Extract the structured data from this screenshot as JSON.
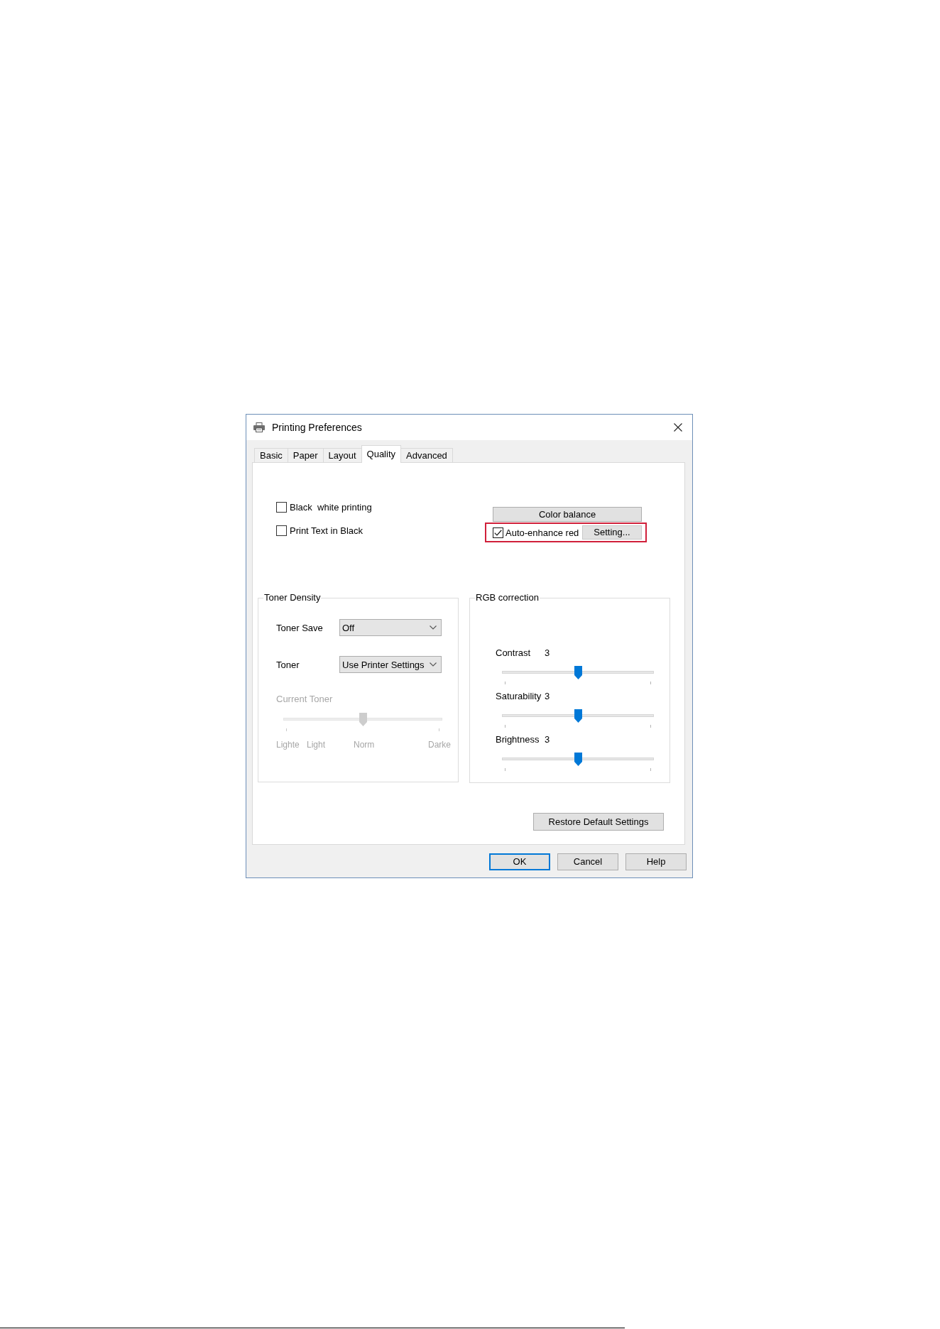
{
  "window": {
    "title": "Printing Preferences"
  },
  "tabs": [
    {
      "label": "Basic",
      "selected": false
    },
    {
      "label": "Paper",
      "selected": false
    },
    {
      "label": "Layout",
      "selected": false
    },
    {
      "label": "Quality",
      "selected": true
    },
    {
      "label": "Advanced",
      "selected": false
    }
  ],
  "options": [
    {
      "label": "Black  white printing",
      "checked": false
    },
    {
      "label": "Print Text in Black",
      "checked": false
    }
  ],
  "color_balance_button": {
    "label": "Color balance"
  },
  "auto_enhance": {
    "label": "Auto-enhance red",
    "checked": true,
    "highlighted": true,
    "button": "Setting..."
  },
  "toner_density": {
    "title": "Toner Density",
    "dropdowns": [
      {
        "label": "Toner Save",
        "value": "Off"
      },
      {
        "label": "Toner",
        "value": "Use Printer Settings"
      }
    ],
    "current_toner": {
      "label": "Current Toner",
      "disabled": true,
      "level": 0.5,
      "scale_labels": [
        "Lighte",
        "Light",
        "Norm",
        "Darke"
      ]
    }
  },
  "rgb_correction": {
    "title": "RGB correction",
    "sliders": [
      {
        "label": "Contrast",
        "reading": "3",
        "level": 0.5
      },
      {
        "label": "Saturability",
        "reading": "3",
        "level": 0.5
      },
      {
        "label": "Brightness",
        "reading": "3",
        "level": 0.5
      }
    ]
  },
  "restore_button": {
    "label": "Restore Default Settings"
  },
  "buttons": [
    {
      "label": "OK",
      "focused": true
    },
    {
      "label": "Cancel",
      "focused": false
    },
    {
      "label": "Help",
      "focused": false
    }
  ]
}
